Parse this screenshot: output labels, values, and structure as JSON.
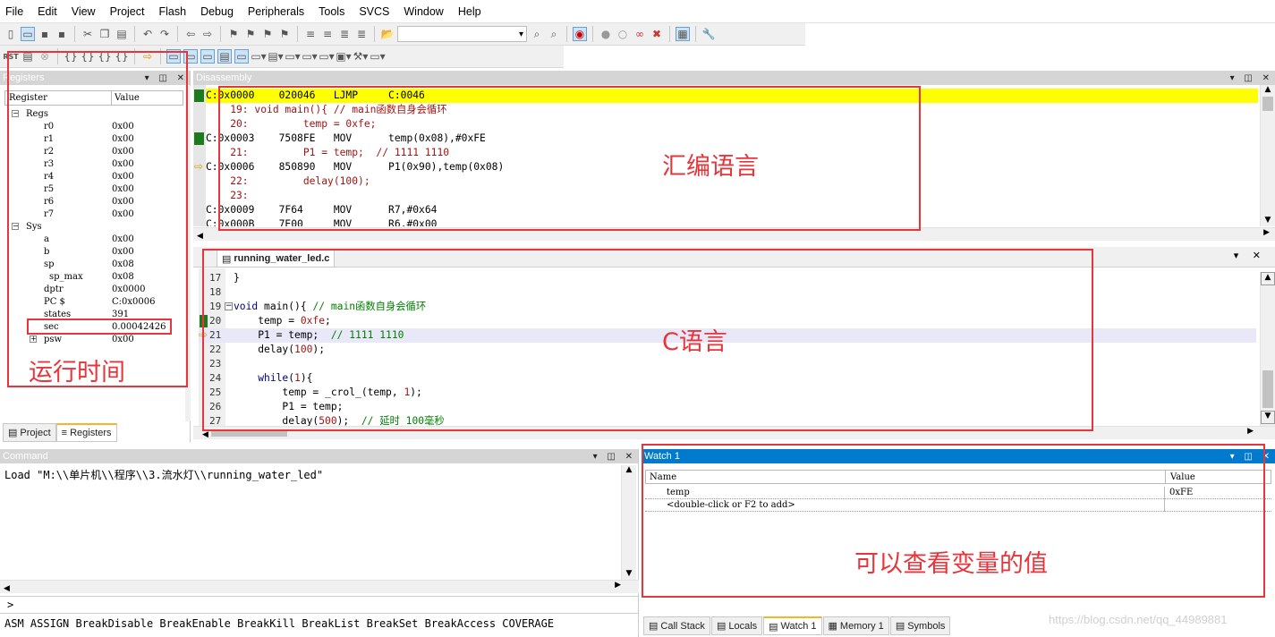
{
  "menu": [
    "File",
    "Edit",
    "View",
    "Project",
    "Flash",
    "Debug",
    "Peripherals",
    "Tools",
    "SVCS",
    "Window",
    "Help"
  ],
  "toolbar": {
    "rst_label": "RST"
  },
  "registers": {
    "title": "Registers",
    "col_register": "Register",
    "col_value": "Value",
    "regs_group": "Regs",
    "regs": [
      {
        "name": "r0",
        "value": "0x00"
      },
      {
        "name": "r1",
        "value": "0x00"
      },
      {
        "name": "r2",
        "value": "0x00"
      },
      {
        "name": "r3",
        "value": "0x00"
      },
      {
        "name": "r4",
        "value": "0x00"
      },
      {
        "name": "r5",
        "value": "0x00"
      },
      {
        "name": "r6",
        "value": "0x00"
      },
      {
        "name": "r7",
        "value": "0x00"
      }
    ],
    "sys_group": "Sys",
    "sys": [
      {
        "name": "a",
        "value": "0x00"
      },
      {
        "name": "b",
        "value": "0x00"
      },
      {
        "name": "sp",
        "value": "0x08"
      },
      {
        "name": "sp_max",
        "value": "0x08"
      },
      {
        "name": "dptr",
        "value": "0x0000"
      },
      {
        "name": "PC  $",
        "value": "C:0x0006"
      },
      {
        "name": "states",
        "value": "391"
      },
      {
        "name": "sec",
        "value": "0.00042426"
      },
      {
        "name": "psw",
        "value": "0x00"
      }
    ],
    "tabs": [
      "Project",
      "Registers"
    ]
  },
  "disassembly": {
    "title": "Disassembly",
    "lines": [
      "C:0x0000    020046   LJMP     C:0046",
      "    19: void main(){ // main函数自身会循环",
      "    20:         temp = 0xfe;",
      "C:0x0003    7508FE   MOV      temp(0x08),#0xFE",
      "    21:         P1 = temp;  // 1111 1110",
      "C:0x0006    850890   MOV      P1(0x90),temp(0x08)",
      "    22:         delay(100);",
      "    23: ",
      "C:0x0009    7F64     MOV      R7,#0x64",
      "C:0x000B    7E00     MOV      R6,#0x00"
    ]
  },
  "editor": {
    "tab": "running_water_led.c",
    "lines": [
      {
        "n": "17",
        "code": "}"
      },
      {
        "n": "18",
        "code": ""
      },
      {
        "n": "19",
        "code": "void main(){ // main函数自身会循环"
      },
      {
        "n": "20",
        "code": "    temp = 0xfe;"
      },
      {
        "n": "21",
        "code": "    P1 = temp;  // 1111 1110"
      },
      {
        "n": "22",
        "code": "    delay(100);"
      },
      {
        "n": "23",
        "code": ""
      },
      {
        "n": "24",
        "code": "    while(1){"
      },
      {
        "n": "25",
        "code": "        temp = _crol_(temp, 1);"
      },
      {
        "n": "26",
        "code": "        P1 = temp;"
      },
      {
        "n": "27",
        "code": "        delay(500);  // 延时 100毫秒"
      }
    ]
  },
  "command": {
    "title": "Command",
    "output": "Load \"M:\\\\单片机\\\\程序\\\\3.流水灯\\\\running_water_led\"",
    "prompt": ">",
    "hints": "ASM ASSIGN BreakDisable BreakEnable BreakKill BreakList BreakSet BreakAccess COVERAGE"
  },
  "watch": {
    "title": "Watch 1",
    "col_name": "Name",
    "col_value": "Value",
    "rows": [
      {
        "name": "temp",
        "value": "0xFE"
      }
    ],
    "add_hint": "<double-click or F2 to add>",
    "tabs": [
      "Call Stack",
      "Locals",
      "Watch 1",
      "Memory 1",
      "Symbols"
    ]
  },
  "annotations": {
    "asm": "汇编语言",
    "c": "C语言",
    "runtime": "运行时间",
    "watch": "可以查看变量的值"
  },
  "watermark": "https://blog.csdn.net/qq_44989881",
  "colors": {
    "annotation": "#e8343b",
    "current_line": "#ffff00",
    "panel_active": "#007acc",
    "keyword": "#000080",
    "string_color": "#a31515"
  }
}
